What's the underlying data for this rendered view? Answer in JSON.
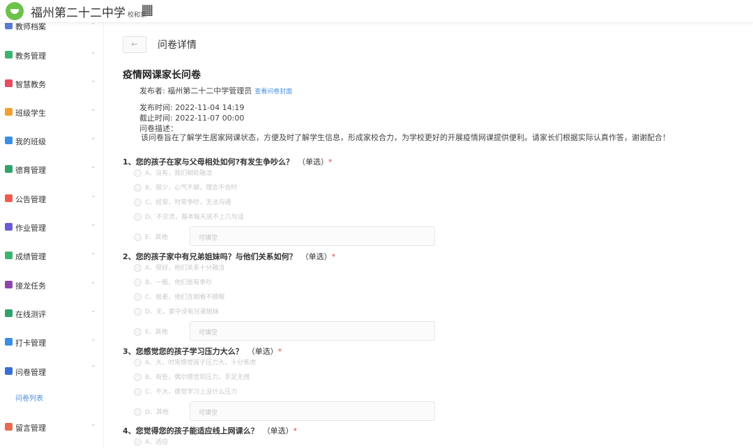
{
  "header": {
    "school_name": "福州第二十二中学",
    "app_sub": "校和家"
  },
  "sidebar": {
    "items": [
      {
        "label": "教师档案",
        "icon_color": "#5b7bd5",
        "icon": "folder-icon",
        "chevron": "⌄"
      },
      {
        "label": "教务管理",
        "icon_color": "#3cb371",
        "icon": "document-icon",
        "chevron": "⌄"
      },
      {
        "label": "智慧教务",
        "icon_color": "#e84a5f",
        "icon": "screen-icon",
        "chevron": "⌄"
      },
      {
        "label": "班级学生",
        "icon_color": "#f0a030",
        "icon": "students-icon",
        "chevron": "⌄"
      },
      {
        "label": "我的班级",
        "icon_color": "#3a8ee6",
        "icon": "graduation-cap-icon",
        "chevron": "⌄"
      },
      {
        "label": "德育管理",
        "icon_color": "#2ea36b",
        "icon": "badge-icon",
        "chevron": "⌄"
      },
      {
        "label": "公告管理",
        "icon_color": "#f05a4f",
        "icon": "megaphone-icon",
        "chevron": "⌄"
      },
      {
        "label": "作业管理",
        "icon_color": "#6b5bd5",
        "icon": "homework-icon",
        "chevron": "⌄"
      },
      {
        "label": "成绩管理",
        "icon_color": "#3cb371",
        "icon": "chart-icon",
        "chevron": "⌄"
      },
      {
        "label": "接龙任务",
        "icon_color": "#8e44ad",
        "icon": "task-icon",
        "chevron": "⌄"
      },
      {
        "label": "在线测评",
        "icon_color": "#2ea36b",
        "icon": "test-icon",
        "chevron": "⌄"
      },
      {
        "label": "打卡管理",
        "icon_color": "#3a8ee6",
        "icon": "location-icon",
        "chevron": "⌄"
      },
      {
        "label": "问卷管理",
        "icon_color": "#3a6ed5",
        "icon": "survey-icon",
        "chevron": "⌃"
      },
      {
        "label": "留言管理",
        "icon_color": "#e86a50",
        "icon": "message-icon",
        "chevron": "⌄"
      }
    ],
    "sub_item": "问卷列表"
  },
  "main": {
    "back_label": "←",
    "page_title": "问卷详情",
    "survey_title": "疫情网课家长问卷",
    "publisher": "发布者: 福州第二十二中学管理员",
    "cover_link": "查看问卷封面",
    "publish_time": "发布时间: 2022-11-04 14:19",
    "deadline": "截止时间: 2022-11-07 00:00",
    "desc_label": "问卷描述：",
    "desc_text": "该问卷旨在了解学生居家网课状态，方便及时了解学生信息，形成家校合力，为学校更好的开展疫情网课提供便利。请家长们根据实际认真作答，谢谢配合！"
  },
  "questions": [
    {
      "title": "1、您的孩子在家与父母相处如何?有发生争吵么？",
      "type": "（单选）",
      "required": "*",
      "options": [
        "A、没有，我们相处融洽",
        "B、很少，心气不顺，理念不合时",
        "C、经常，时常争吵，无法沟通",
        "D、不交流，基本每天说不上几句话",
        "E、其他"
      ],
      "fill_placeholder": "可填空"
    },
    {
      "title": "2、您的孩子家中有兄弟姐妹吗？与他们关系如何？",
      "type": "（单选）",
      "required": "*",
      "options": [
        "A、很好，他们关系十分融洽",
        "B、一般，他们是有争吵",
        "C、极差，他们互相看不顺眼",
        "D、无，家中没有兄弟姐妹",
        "E、其他"
      ],
      "fill_placeholder": "可填空"
    },
    {
      "title": "3、您感觉您的孩子学习压力大么？",
      "type": "（单选）",
      "required": "*",
      "options": [
        "A、大，时常感觉孩子压力大，十分焦虑",
        "B、有些，偶尔感觉到压力，手足无措",
        "C、不大，感觉学习上没什么压力",
        "D、其他"
      ],
      "fill_placeholder": "可填空"
    },
    {
      "title": "4、您觉得您的孩子能适应线上网课么？",
      "type": "（单选）",
      "required": "*",
      "options": [
        "A、适应"
      ]
    }
  ]
}
